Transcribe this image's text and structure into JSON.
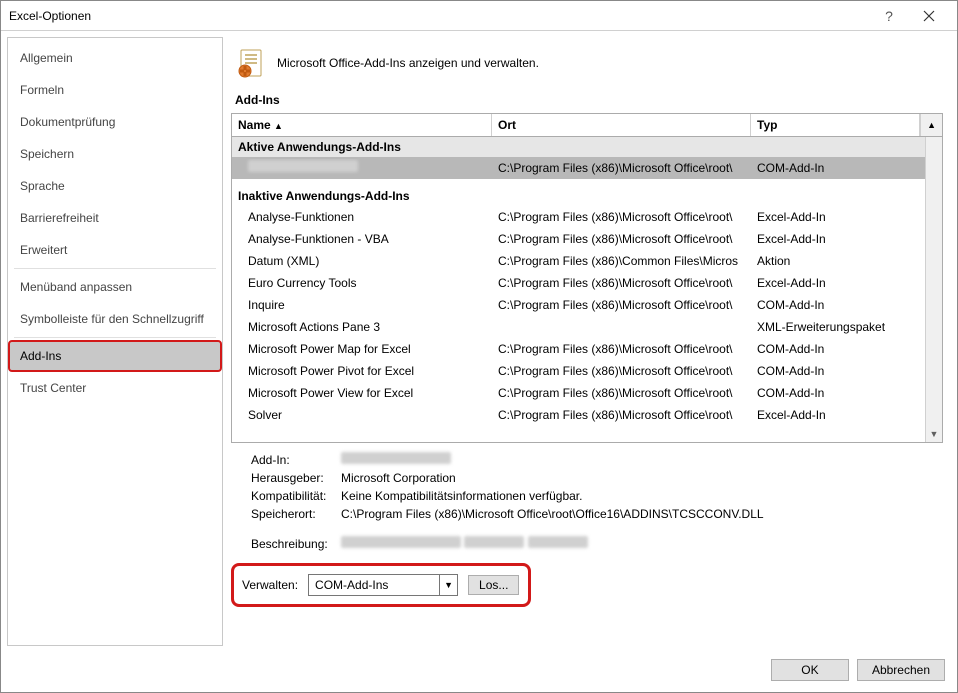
{
  "window": {
    "title": "Excel-Optionen"
  },
  "sidebar": {
    "items": [
      {
        "label": "Allgemein"
      },
      {
        "label": "Formeln"
      },
      {
        "label": "Dokumentprüfung"
      },
      {
        "label": "Speichern"
      },
      {
        "label": "Sprache"
      },
      {
        "label": "Barrierefreiheit"
      },
      {
        "label": "Erweitert"
      },
      {
        "label": "Menüband anpassen"
      },
      {
        "label": "Symbolleiste für den Schnellzugriff"
      },
      {
        "label": "Add-Ins"
      },
      {
        "label": "Trust Center"
      }
    ]
  },
  "header": {
    "subtitle": "Microsoft Office-Add-Ins anzeigen und verwalten."
  },
  "section": {
    "title": "Add-Ins"
  },
  "table": {
    "headers": {
      "name": "Name",
      "ort": "Ort",
      "typ": "Typ"
    },
    "group_active": "Aktive Anwendungs-Add-Ins",
    "group_inactive": "Inaktive Anwendungs-Add-Ins",
    "active": [
      {
        "name": "",
        "ort": "C:\\Program Files (x86)\\Microsoft Office\\root\\",
        "typ": "COM-Add-In"
      }
    ],
    "inactive": [
      {
        "name": "Analyse-Funktionen",
        "ort": "C:\\Program Files (x86)\\Microsoft Office\\root\\",
        "typ": "Excel-Add-In"
      },
      {
        "name": "Analyse-Funktionen - VBA",
        "ort": "C:\\Program Files (x86)\\Microsoft Office\\root\\",
        "typ": "Excel-Add-In"
      },
      {
        "name": "Datum (XML)",
        "ort": "C:\\Program Files (x86)\\Common Files\\Micros",
        "typ": "Aktion"
      },
      {
        "name": "Euro Currency Tools",
        "ort": "C:\\Program Files (x86)\\Microsoft Office\\root\\",
        "typ": "Excel-Add-In"
      },
      {
        "name": "Inquire",
        "ort": "C:\\Program Files (x86)\\Microsoft Office\\root\\",
        "typ": "COM-Add-In"
      },
      {
        "name": "Microsoft Actions Pane 3",
        "ort": "",
        "typ": "XML-Erweiterungspaket"
      },
      {
        "name": "Microsoft Power Map for Excel",
        "ort": "C:\\Program Files (x86)\\Microsoft Office\\root\\",
        "typ": "COM-Add-In"
      },
      {
        "name": "Microsoft Power Pivot for Excel",
        "ort": "C:\\Program Files (x86)\\Microsoft Office\\root\\",
        "typ": "COM-Add-In"
      },
      {
        "name": "Microsoft Power View for Excel",
        "ort": "C:\\Program Files (x86)\\Microsoft Office\\root\\",
        "typ": "COM-Add-In"
      },
      {
        "name": "Solver",
        "ort": "C:\\Program Files (x86)\\Microsoft Office\\root\\",
        "typ": "Excel-Add-In"
      }
    ]
  },
  "details": {
    "labels": {
      "addin": "Add-In:",
      "herausgeber": "Herausgeber:",
      "kompat": "Kompatibilität:",
      "speicherort": "Speicherort:",
      "beschreibung": "Beschreibung:"
    },
    "values": {
      "herausgeber": "Microsoft Corporation",
      "kompat": "Keine Kompatibilitätsinformationen verfügbar.",
      "speicherort": "C:\\Program Files (x86)\\Microsoft Office\\root\\Office16\\ADDINS\\TCSCCONV.DLL"
    }
  },
  "manage": {
    "label": "Verwalten:",
    "selected": "COM-Add-Ins",
    "go": "Los..."
  },
  "footer": {
    "ok": "OK",
    "cancel": "Abbrechen"
  }
}
